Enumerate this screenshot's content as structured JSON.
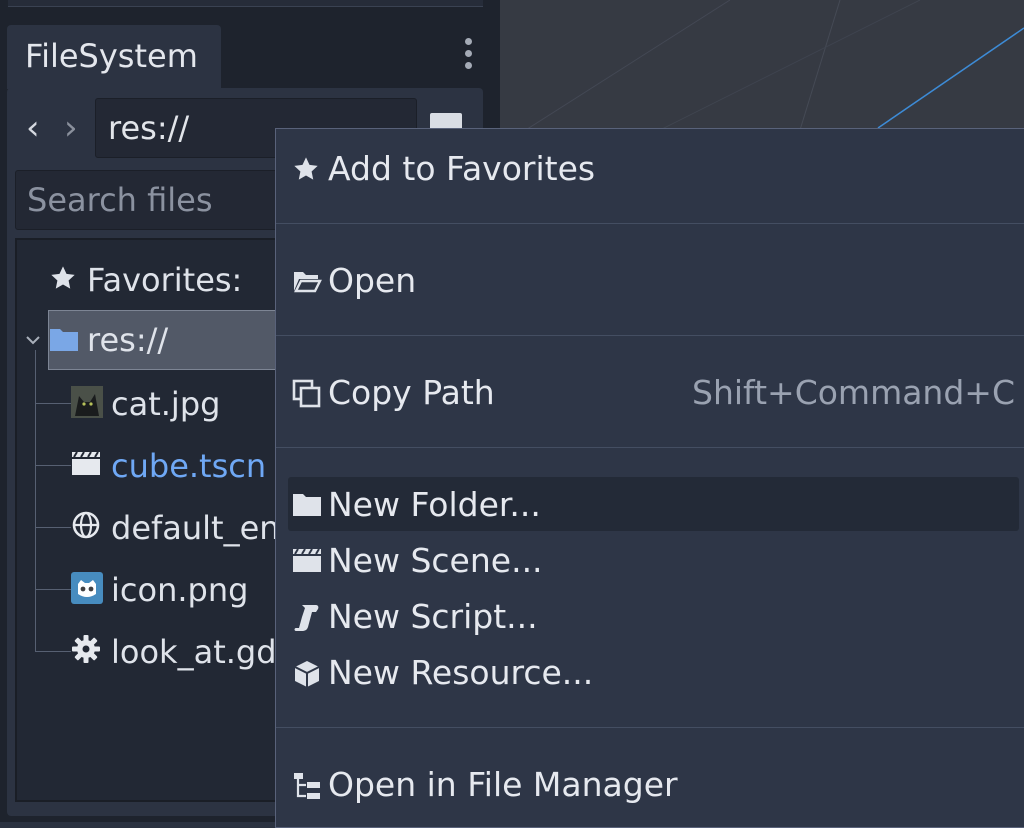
{
  "dock": {
    "tab_title": "FileSystem",
    "nav_back": "‹",
    "nav_forward": "›",
    "path_value": "res://",
    "search_placeholder": "Search files"
  },
  "tree": {
    "favorites_label": "Favorites:",
    "root_label": "res://",
    "files": [
      {
        "name": "cat.jpg",
        "icon": "image-thumbnail-icon"
      },
      {
        "name": "cube.tscn",
        "icon": "scene-clapper-icon",
        "color": "#6fa8f5"
      },
      {
        "name": "default_env.tres",
        "icon": "environment-globe-icon"
      },
      {
        "name": "icon.png",
        "icon": "godot-logo-icon"
      },
      {
        "name": "look_at.gd",
        "icon": "gear-script-icon"
      }
    ]
  },
  "context_menu": {
    "items": [
      {
        "label": "Add to Favorites",
        "icon": "star-icon"
      },
      {
        "label": "Open",
        "icon": "folder-open-icon"
      },
      {
        "label": "Copy Path",
        "icon": "copy-icon",
        "shortcut": "Shift+Command+C"
      },
      {
        "label": "New Folder...",
        "icon": "folder-icon",
        "highlighted": true
      },
      {
        "label": "New Scene...",
        "icon": "clapper-icon"
      },
      {
        "label": "New Script...",
        "icon": "script-icon"
      },
      {
        "label": "New Resource...",
        "icon": "cube-icon"
      },
      {
        "label": "Open in File Manager",
        "icon": "file-tree-icon"
      }
    ]
  },
  "colors": {
    "accent_blue": "#6fa8f5",
    "menu_bg": "#2e3647",
    "panel_bg": "#2c3342"
  }
}
